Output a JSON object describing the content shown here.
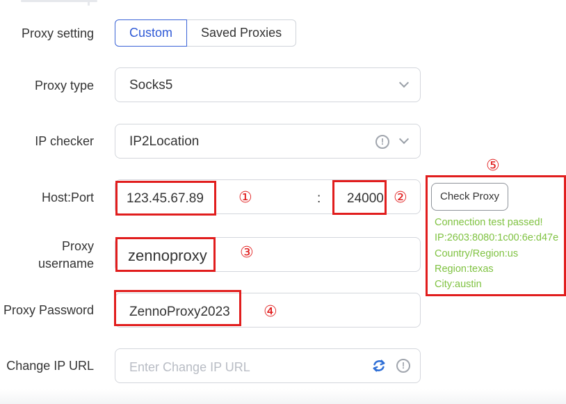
{
  "form": {
    "proxy_setting": {
      "label": "Proxy setting",
      "tabs": [
        "Custom",
        "Saved Proxies"
      ],
      "selected": "Custom"
    },
    "proxy_type": {
      "label": "Proxy type",
      "value": "Socks5"
    },
    "ip_checker": {
      "label": "IP checker",
      "value": "IP2Location"
    },
    "host_port": {
      "label": "Host:Port",
      "host": "123.45.67.89",
      "separator": ":",
      "port": "24000"
    },
    "username": {
      "label_line1": "Proxy",
      "label_line2": "username",
      "value": "zennoproxy"
    },
    "password": {
      "label": "Proxy Password",
      "value": "ZennoProxy2023"
    },
    "change_ip_url": {
      "label": "Change IP URL",
      "placeholder": "Enter Change IP URL"
    }
  },
  "check_proxy": {
    "button_label": "Check Proxy",
    "results": [
      "Connection test passed!",
      "IP:2603:8080:1c00:6e:d47e",
      "Country/Region:us",
      "Region:texas",
      "City:austin"
    ]
  },
  "annotations": {
    "markers": [
      "①",
      "②",
      "③",
      "④",
      "⑤"
    ],
    "color": "#e11d1d"
  },
  "colors": {
    "accent": "#2f5ad6",
    "success": "#7fc241",
    "annotation": "#e11d1d",
    "refresh_icon": "#2f6fd6"
  },
  "icons": {
    "dropdown": "chevron-down-icon",
    "info": "info-circle-icon",
    "refresh": "refresh-icon"
  }
}
